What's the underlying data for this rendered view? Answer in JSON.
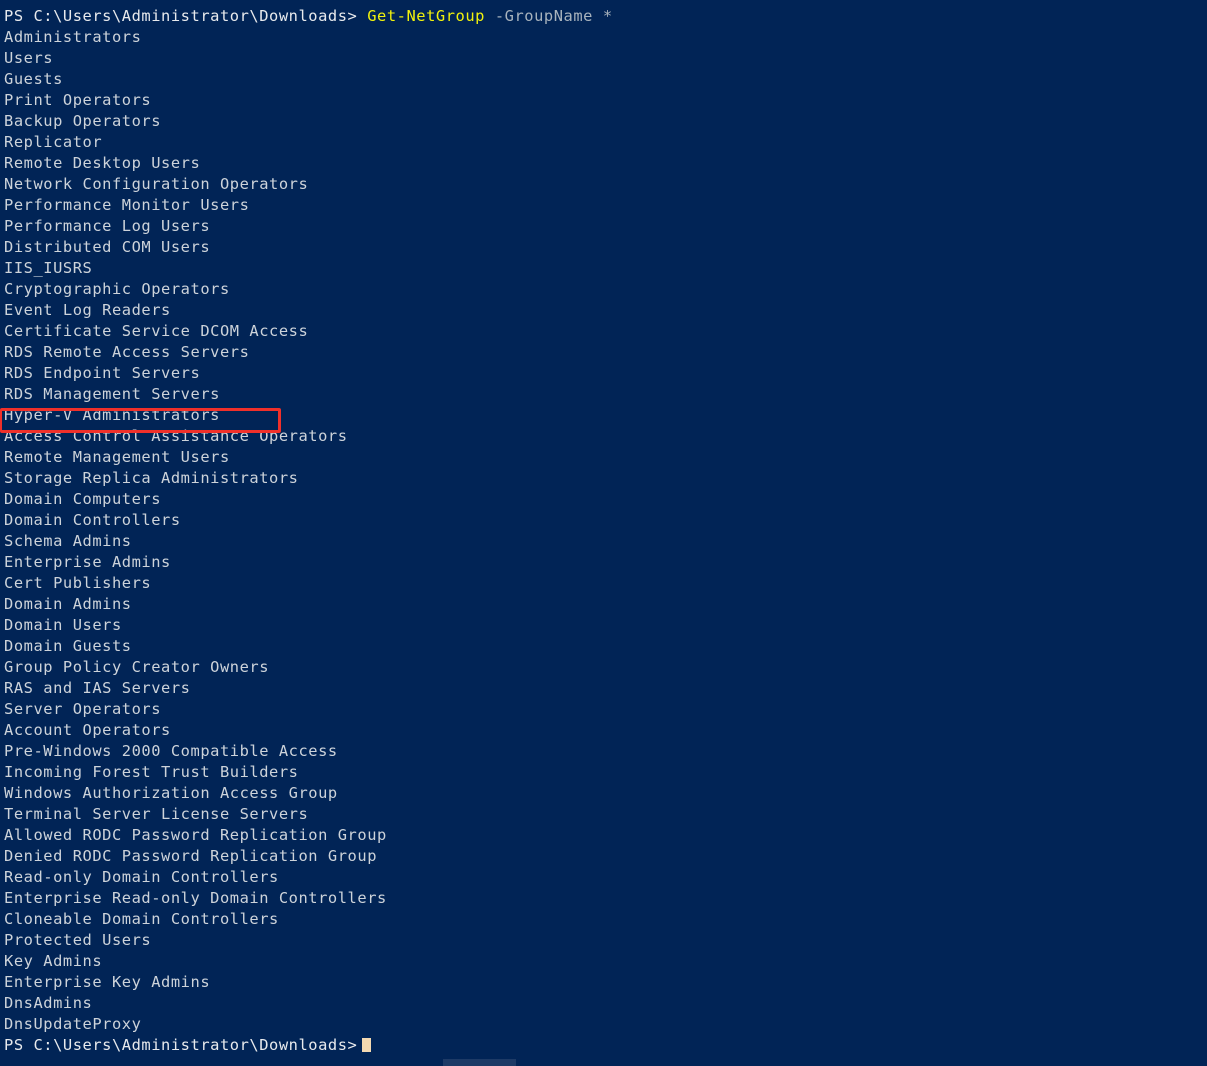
{
  "terminal": {
    "app": "Windows PowerShell",
    "background_color": "#012456",
    "foreground_color": "#cdd3da",
    "command_color": "#f2f20c",
    "parameter_color": "#a8b3bd",
    "cursor_color": "#f3d9b1",
    "annotation_color": "#f0302a"
  },
  "command_line": {
    "prompt": "PS C:\\Users\\Administrator\\Downloads>",
    "command": "Get-NetGroup",
    "parameter": "-GroupName",
    "argument": "*"
  },
  "output_lines": [
    "Administrators",
    "Users",
    "Guests",
    "Print Operators",
    "Backup Operators",
    "Replicator",
    "Remote Desktop Users",
    "Network Configuration Operators",
    "Performance Monitor Users",
    "Performance Log Users",
    "Distributed COM Users",
    "IIS_IUSRS",
    "Cryptographic Operators",
    "Event Log Readers",
    "Certificate Service DCOM Access",
    "RDS Remote Access Servers",
    "RDS Endpoint Servers",
    "RDS Management Servers",
    "Hyper-V Administrators",
    "Access Control Assistance Operators",
    "Remote Management Users",
    "Storage Replica Administrators",
    "Domain Computers",
    "Domain Controllers",
    "Schema Admins",
    "Enterprise Admins",
    "Cert Publishers",
    "Domain Admins",
    "Domain Users",
    "Domain Guests",
    "Group Policy Creator Owners",
    "RAS and IAS Servers",
    "Server Operators",
    "Account Operators",
    "Pre-Windows 2000 Compatible Access",
    "Incoming Forest Trust Builders",
    "Windows Authorization Access Group",
    "Terminal Server License Servers",
    "Allowed RODC Password Replication Group",
    "Denied RODC Password Replication Group",
    "Read-only Domain Controllers",
    "Enterprise Read-only Domain Controllers",
    "Cloneable Domain Controllers",
    "Protected Users",
    "Key Admins",
    "Enterprise Key Admins",
    "DnsAdmins",
    "DnsUpdateProxy"
  ],
  "highlighted_line": "Hyper-V Administrators",
  "final_prompt": {
    "prompt": "PS C:\\Users\\Administrator\\Downloads>"
  }
}
